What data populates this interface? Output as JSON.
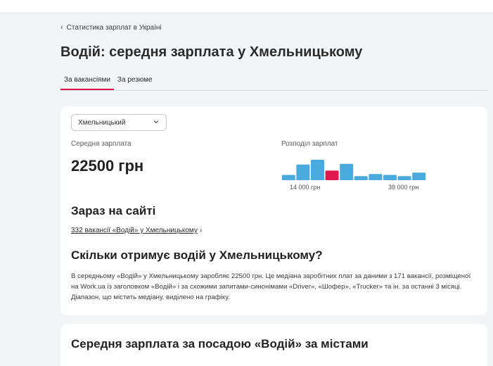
{
  "topbar": {
    "text": ""
  },
  "breadcrumb": {
    "label": "Статистика зарплат в Україні"
  },
  "page": {
    "title": "Водій: середня зарплата у Хмельницькому"
  },
  "tabs": [
    {
      "label": "За вакансіями",
      "active": true
    },
    {
      "label": "За резюме",
      "active": false
    }
  ],
  "filter": {
    "city": "Хмельницький"
  },
  "stats": {
    "avg_label": "Середня зарплата",
    "avg_value": "22500 грн",
    "dist_label": "Розподіл зарплат",
    "dist_min_label": "14 000 грн",
    "dist_max_label": "38 000 грн"
  },
  "chart_data": {
    "type": "bar",
    "values": [
      0.26,
      0.77,
      1.0,
      0.47,
      0.8,
      0.2,
      0.3,
      0.26,
      0.2,
      0.37
    ],
    "highlight_index": 3,
    "colors": {
      "bar": "#4aa9dd",
      "highlight": "#e0164e",
      "baseline": "#cfe6f5"
    }
  },
  "now": {
    "title": "Зараз на сайті",
    "link": "332 вакансії «Водій» у Хмельницькому"
  },
  "how": {
    "title": "Скільки отримує водій у Хмельницькому?",
    "description": "В середньому «Водій» у Хмельницькому заробляє 22500 грн. Це медіана заробітних плат за даними з 171 вакансії, розміщеної на Work.ua із заголовком «Водій» і за схожими запитами-синонімами «Driver», «Шофер», «Trucker» та ін. за останні 3 місяці. Діапазон, що містить медіану, виділено на графіку."
  },
  "cities": {
    "title": "Середня зарплата за посадою «Водій» за містами"
  },
  "colors": {
    "accent": "#e0164e",
    "bar": "#4aa9dd"
  }
}
